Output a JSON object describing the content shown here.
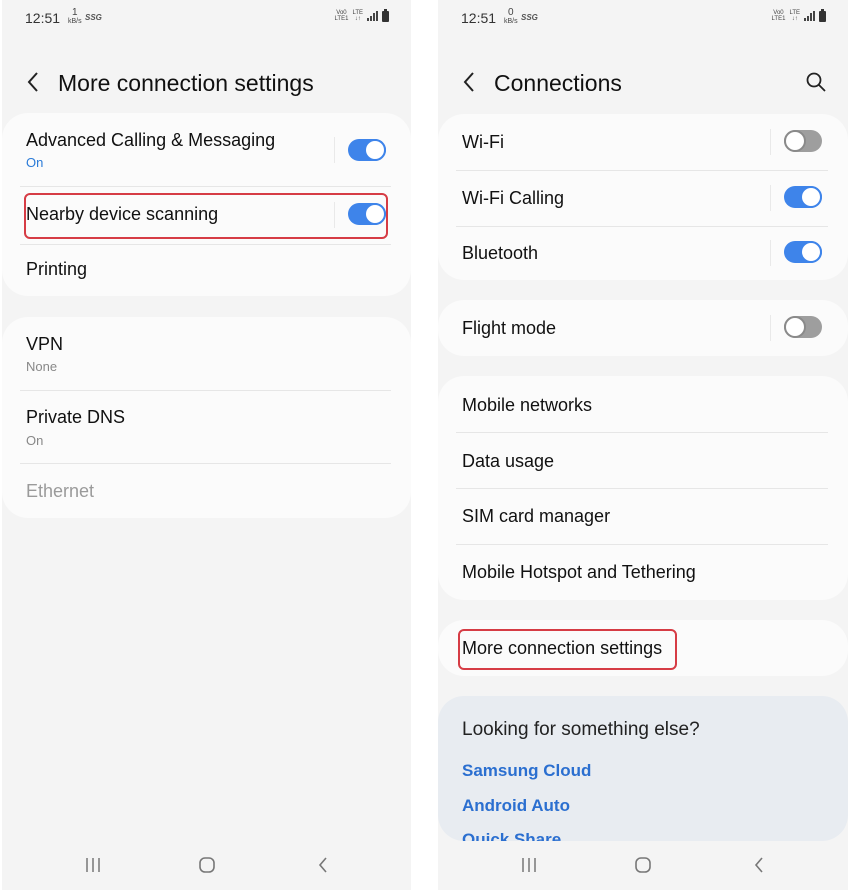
{
  "left": {
    "status": {
      "time": "12:51",
      "net_speed_value": "1",
      "net_speed_unit": "kB/s",
      "carrier_badge": "SSG",
      "volte": "Vo0 LTE1",
      "lte": "LTE"
    },
    "header": {
      "title": "More connection settings",
      "back_icon": "chevron-left-icon"
    },
    "group1": [
      {
        "title": "Advanced Calling & Messaging",
        "subtitle": "On",
        "toggle": true
      },
      {
        "title": "Nearby device scanning",
        "toggle": true,
        "highlighted": true
      },
      {
        "title": "Printing"
      }
    ],
    "group2": [
      {
        "title": "VPN",
        "subtitle": "None"
      },
      {
        "title": "Private DNS",
        "subtitle": "On"
      },
      {
        "title": "Ethernet",
        "disabled": true
      }
    ]
  },
  "right": {
    "status": {
      "time": "12:51",
      "net_speed_value": "0",
      "net_speed_unit": "kB/s",
      "carrier_badge": "SSG",
      "volte": "Vo0 LTE1",
      "lte": "LTE"
    },
    "header": {
      "title": "Connections",
      "back_icon": "chevron-left-icon",
      "search_icon": "search-icon"
    },
    "group1": [
      {
        "title": "Wi-Fi",
        "toggle": false
      },
      {
        "title": "Wi-Fi Calling",
        "toggle": true
      },
      {
        "title": "Bluetooth",
        "toggle": true
      }
    ],
    "group2": [
      {
        "title": "Flight mode",
        "toggle": false
      }
    ],
    "group3": [
      {
        "title": "Mobile networks"
      },
      {
        "title": "Data usage"
      },
      {
        "title": "SIM card manager"
      },
      {
        "title": "Mobile Hotspot and Tethering"
      }
    ],
    "group4": [
      {
        "title": "More connection settings",
        "highlighted": true
      }
    ],
    "suggestions": {
      "title": "Looking for something else?",
      "links": [
        "Samsung Cloud",
        "Android Auto",
        "Quick Share"
      ]
    }
  },
  "nav": {
    "recents": "recents-icon",
    "home": "home-icon",
    "back": "back-icon"
  },
  "colors": {
    "accent": "#3e84ea",
    "highlight": "#d63c45",
    "link": "#2b6fd0",
    "background": "#f4f4f4",
    "card": "#fbfbfb"
  }
}
